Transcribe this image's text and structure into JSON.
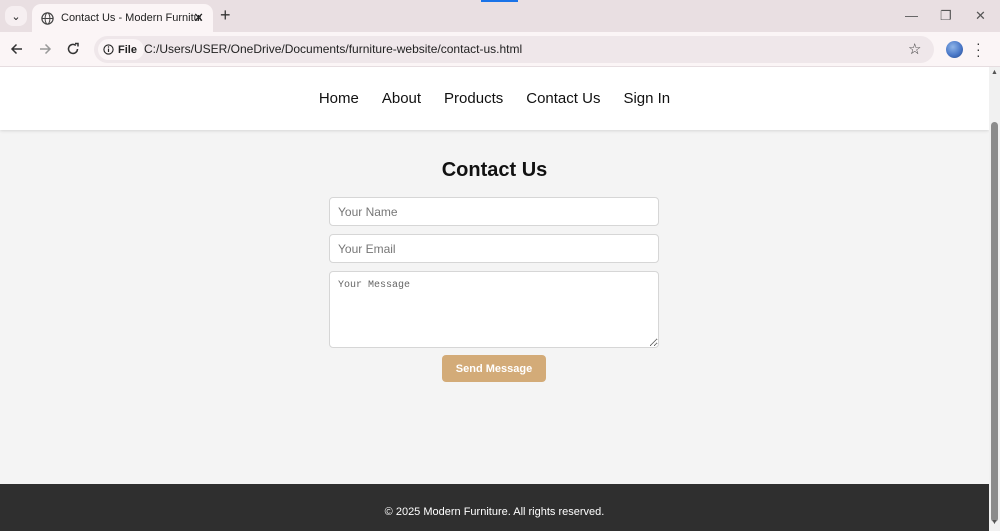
{
  "browser": {
    "tab_title": "Contact Us - Modern Furniture",
    "file_chip": "File",
    "url": "C:/Users/USER/OneDrive/Documents/furniture-website/contact-us.html",
    "accent": "#1a73e8"
  },
  "nav": {
    "items": [
      "Home",
      "About",
      "Products",
      "Contact Us",
      "Sign In"
    ]
  },
  "contact": {
    "title": "Contact Us",
    "name_placeholder": "Your Name",
    "email_placeholder": "Your Email",
    "message_placeholder": "Your Message",
    "send_label": "Send Message",
    "button_color": "#d3ab78"
  },
  "footer": {
    "text": "© 2025 Modern Furniture. All rights reserved."
  }
}
